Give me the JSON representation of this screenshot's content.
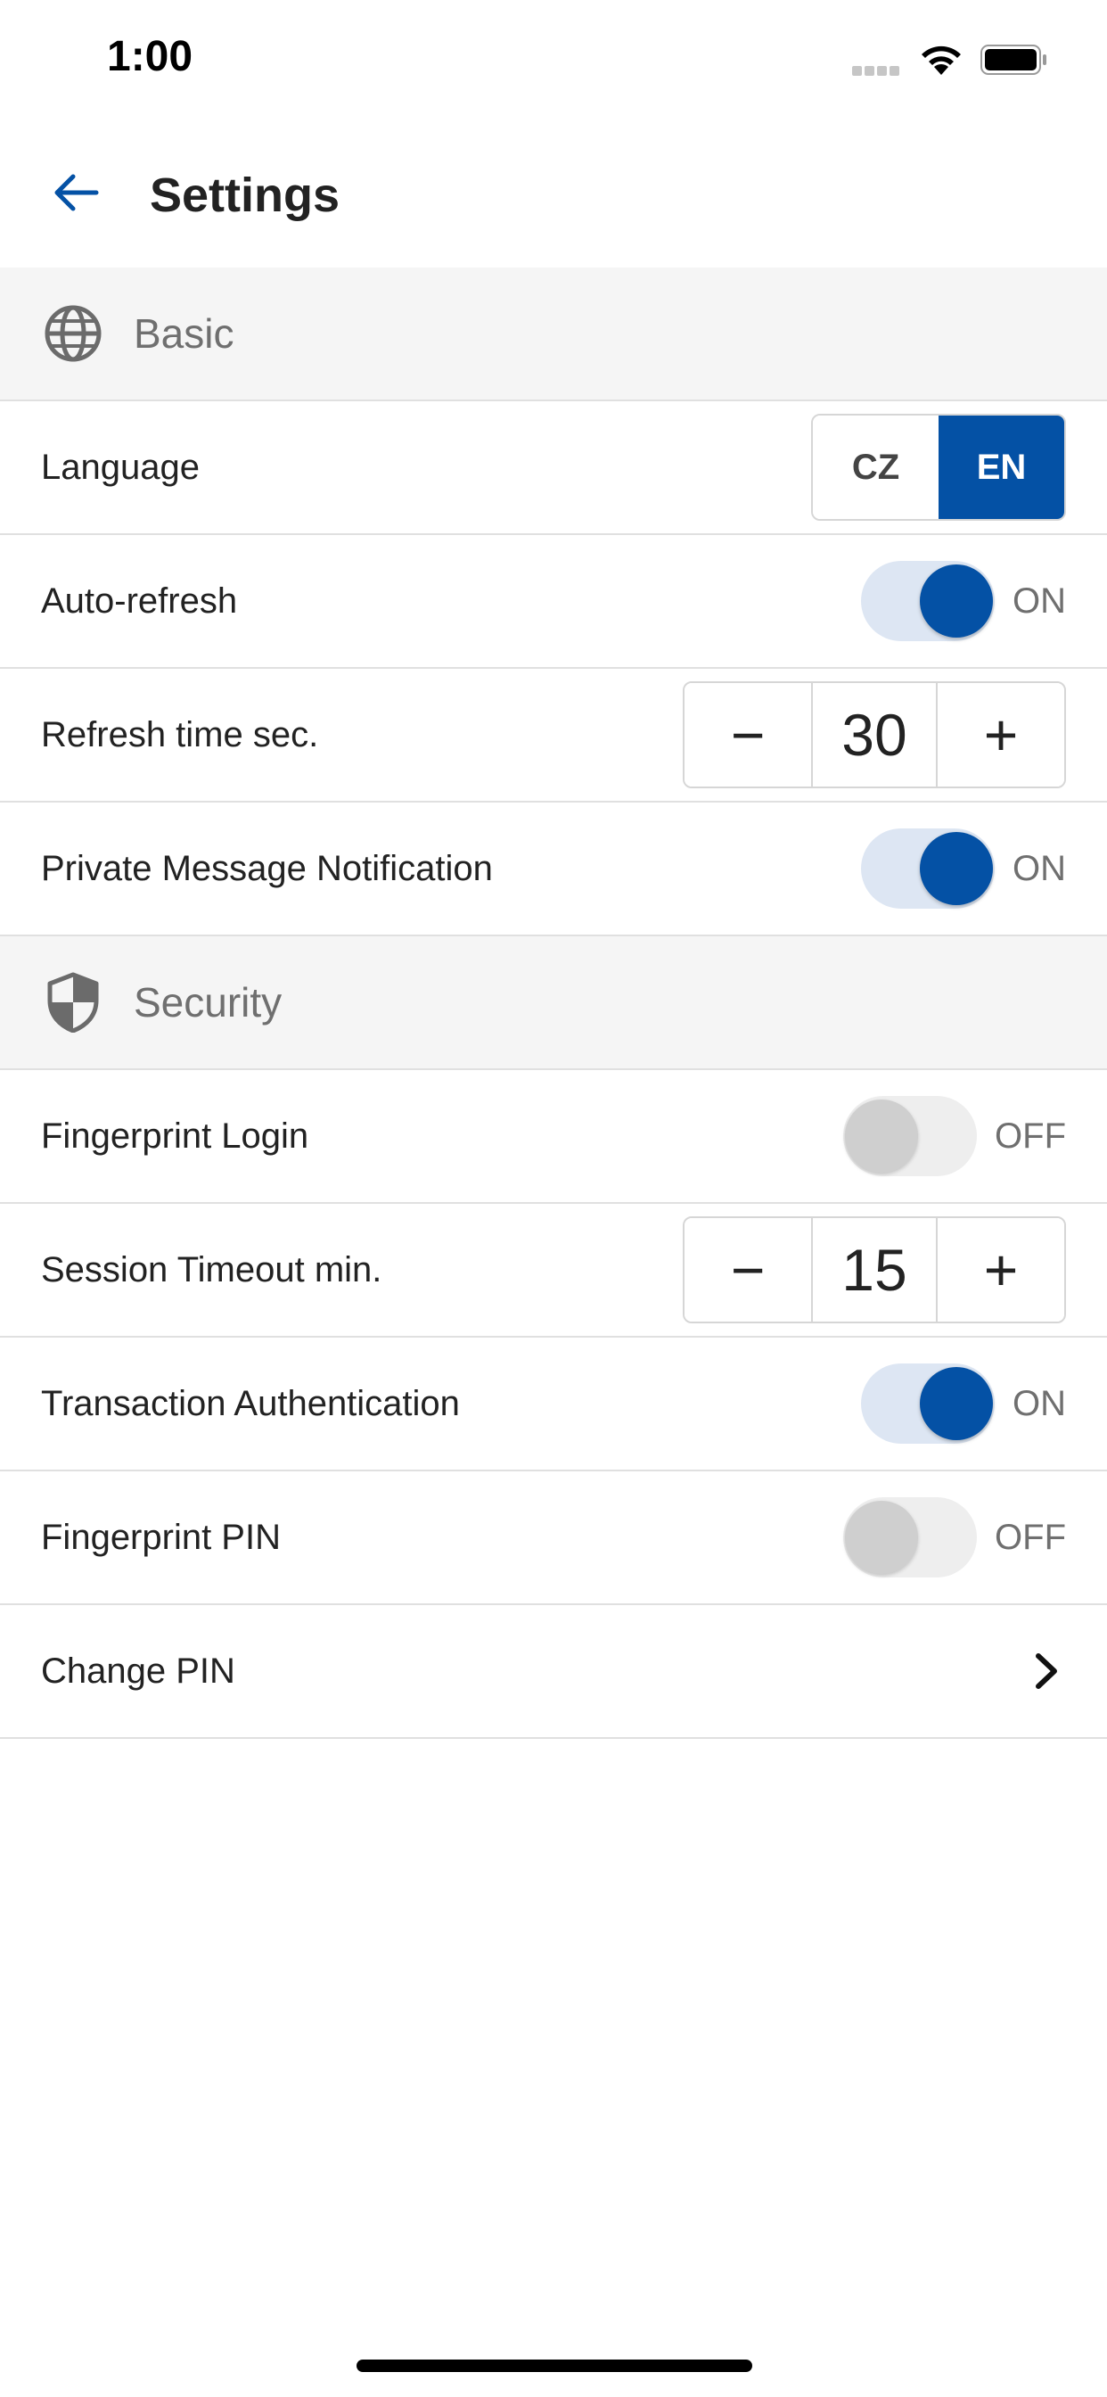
{
  "status_bar": {
    "time": "1:00"
  },
  "header": {
    "title": "Settings",
    "back_icon": "arrow-left-icon"
  },
  "colors": {
    "accent": "#0451a5",
    "section_bg": "#f5f5f5",
    "divider": "#e0e0e0"
  },
  "sections": {
    "basic": {
      "label": "Basic",
      "icon": "globe-icon",
      "language": {
        "label": "Language",
        "options": [
          "CZ",
          "EN"
        ],
        "selected": "EN"
      },
      "auto_refresh": {
        "label": "Auto-refresh",
        "state": "ON"
      },
      "refresh_time": {
        "label": "Refresh time sec.",
        "value": "30",
        "minus": "−",
        "plus": "+"
      },
      "private_message": {
        "label": "Private Message Notification",
        "state": "ON"
      }
    },
    "security": {
      "label": "Security",
      "icon": "shield-icon",
      "fingerprint_login": {
        "label": "Fingerprint Login",
        "state": "OFF"
      },
      "session_timeout": {
        "label": "Session Timeout min.",
        "value": "15",
        "minus": "−",
        "plus": "+"
      },
      "transaction_auth": {
        "label": "Transaction Authentication",
        "state": "ON"
      },
      "fingerprint_pin": {
        "label": "Fingerprint PIN",
        "state": "OFF"
      },
      "change_pin": {
        "label": "Change PIN",
        "icon": "chevron-right-icon"
      }
    }
  }
}
